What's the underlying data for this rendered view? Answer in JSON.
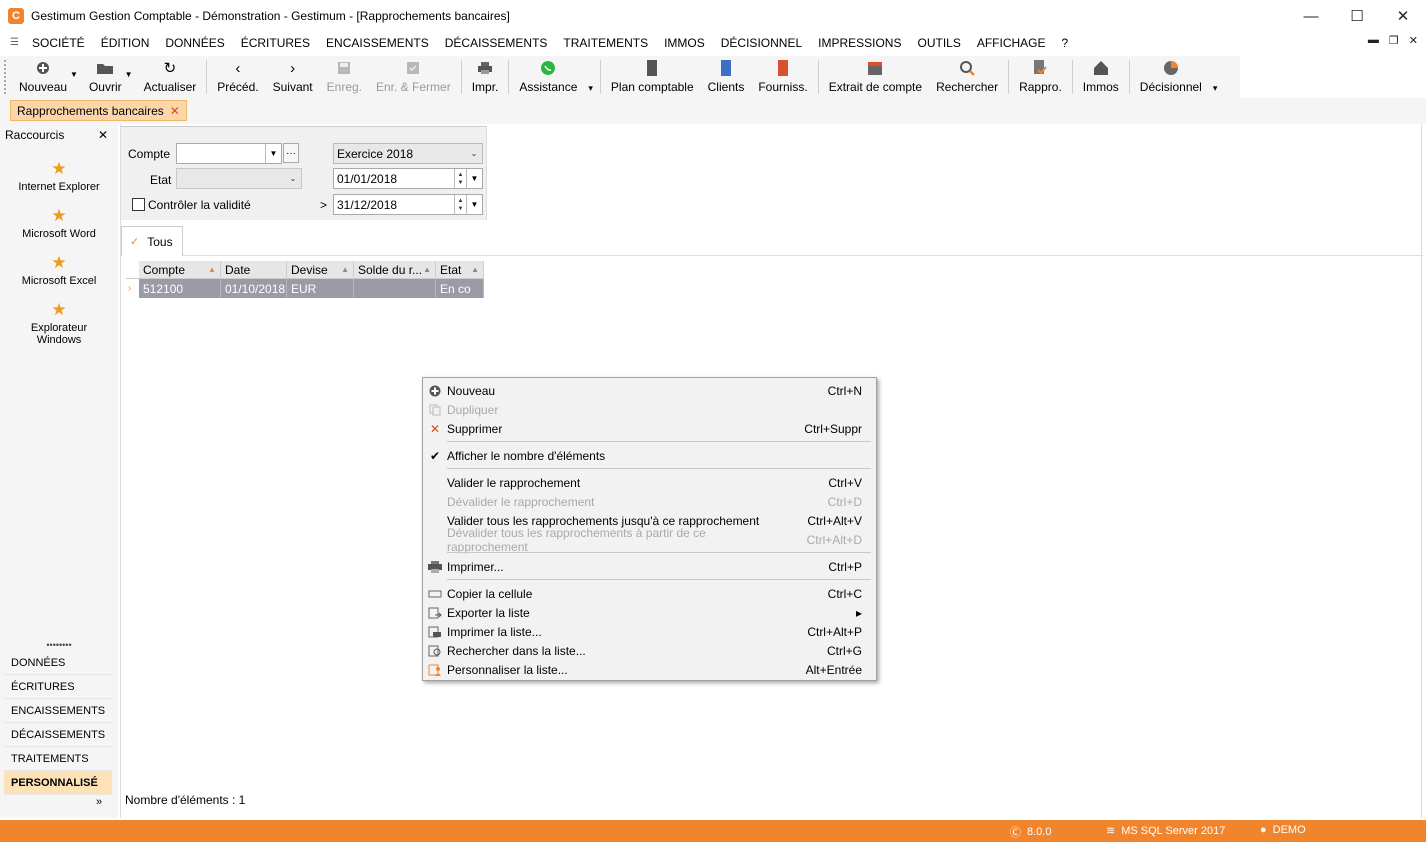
{
  "window": {
    "title": "Gestimum Gestion Comptable - Démonstration - Gestimum - [Rapprochements bancaires]",
    "app_icon": "C",
    "minimize": "—",
    "maximize": "☐",
    "close": "✕"
  },
  "menu": [
    "SOCIÉTÉ",
    "ÉDITION",
    "DONNÉES",
    "ÉCRITURES",
    "ENCAISSEMENTS",
    "DÉCAISSEMENTS",
    "TRAITEMENTS",
    "IMMOS",
    "DÉCISIONNEL",
    "IMPRESSIONS",
    "OUTILS",
    "AFFICHAGE",
    "?"
  ],
  "toolbar": {
    "nouveau": "Nouveau",
    "ouvrir": "Ouvrir",
    "actualiser": "Actualiser",
    "preced": "Précéd.",
    "suivant": "Suivant",
    "enreg": "Enreg.",
    "enr_fermer": "Enr. & Fermer",
    "impr": "Impr.",
    "assistance": "Assistance",
    "plan_comptable": "Plan comptable",
    "clients": "Clients",
    "fourniss": "Fourniss.",
    "extrait": "Extrait de compte",
    "rechercher": "Rechercher",
    "rappro": "Rappro.",
    "immos": "Immos",
    "decisionnel": "Décisionnel"
  },
  "doc_tab": "Rapprochements bancaires",
  "left_panel": {
    "title": "Raccourcis",
    "shortcuts": [
      "Internet Explorer",
      "Microsoft Word",
      "Microsoft Excel",
      "Explorateur Windows"
    ],
    "nav": [
      "DONNÉES",
      "ÉCRITURES",
      "ENCAISSEMENTS",
      "DÉCAISSEMENTS",
      "TRAITEMENTS",
      "PERSONNALISÉ"
    ],
    "dots": "••••••••",
    "more": "»"
  },
  "filters": {
    "compte_label": "Compte",
    "etat_label": "Etat",
    "controler_label": "Contrôler la validité",
    "exercice": "Exercice 2018",
    "date_from": "01/01/2018",
    "date_to_prefix": ">",
    "date_to": "31/12/2018",
    "ellipsis": "···"
  },
  "grid": {
    "tab_label": "Tous",
    "columns": [
      "Compte",
      "Date",
      "Devise",
      "Solde du r...",
      "Etat"
    ],
    "rows": [
      {
        "compte": "512100",
        "date": "01/10/2018",
        "devise": "EUR",
        "solde": "",
        "etat": "En co"
      }
    ]
  },
  "count_label": "Nombre d'éléments : 1",
  "context_menu": {
    "items": [
      {
        "label": "Nouveau",
        "shortcut": "Ctrl+N"
      },
      {
        "label": "Dupliquer",
        "shortcut": ""
      },
      {
        "label": "Supprimer",
        "shortcut": "Ctrl+Suppr"
      },
      {
        "label": "Afficher le nombre d'éléments",
        "shortcut": ""
      },
      {
        "label": "Valider le rapprochement",
        "shortcut": "Ctrl+V"
      },
      {
        "label": "Dévalider le rapprochement",
        "shortcut": "Ctrl+D"
      },
      {
        "label": "Valider tous les rapprochements jusqu'à ce rapprochement",
        "shortcut": "Ctrl+Alt+V"
      },
      {
        "label": "Dévalider tous les rapprochements à partir de ce rapprochement",
        "shortcut": "Ctrl+Alt+D"
      },
      {
        "label": "Imprimer...",
        "shortcut": "Ctrl+P"
      },
      {
        "label": "Copier la cellule",
        "shortcut": "Ctrl+C"
      },
      {
        "label": "Exporter la liste",
        "shortcut": "▸"
      },
      {
        "label": "Imprimer la liste...",
        "shortcut": "Ctrl+Alt+P"
      },
      {
        "label": "Rechercher dans la liste...",
        "shortcut": "Ctrl+G"
      },
      {
        "label": "Personnaliser la liste...",
        "shortcut": "Alt+Entrée"
      }
    ]
  },
  "status": {
    "version": "8.0.0",
    "server": "MS SQL Server 2017",
    "user": "DEMO"
  },
  "colors": {
    "accent": "#f0852d",
    "selected_row": "#9a9ba7",
    "tab_bg": "#fcd6a9"
  }
}
